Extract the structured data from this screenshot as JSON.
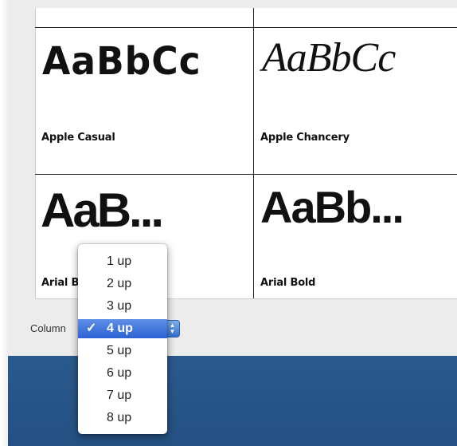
{
  "font_grid": {
    "cells": [
      {
        "sample": "AaBbCc",
        "name": "Apple Casual"
      },
      {
        "sample": "AaBbCc",
        "name": "Apple Chancery"
      },
      {
        "sample": "AaB...",
        "name": "Arial Black"
      },
      {
        "sample": "AaBb...",
        "name": "Arial Bold"
      }
    ],
    "partial_label": "Arial B"
  },
  "columns": {
    "label": "Column",
    "selected": "4 up",
    "check_glyph": "✓",
    "options": [
      "1 up",
      "2 up",
      "3 up",
      "4 up",
      "5 up",
      "6 up",
      "7 up",
      "8 up"
    ]
  },
  "icons": {
    "stepper": "up-down-arrows-icon",
    "check": "checkmark-icon"
  },
  "colors": {
    "selection": "#2c62d3",
    "desktop": "#2a5a8c"
  }
}
